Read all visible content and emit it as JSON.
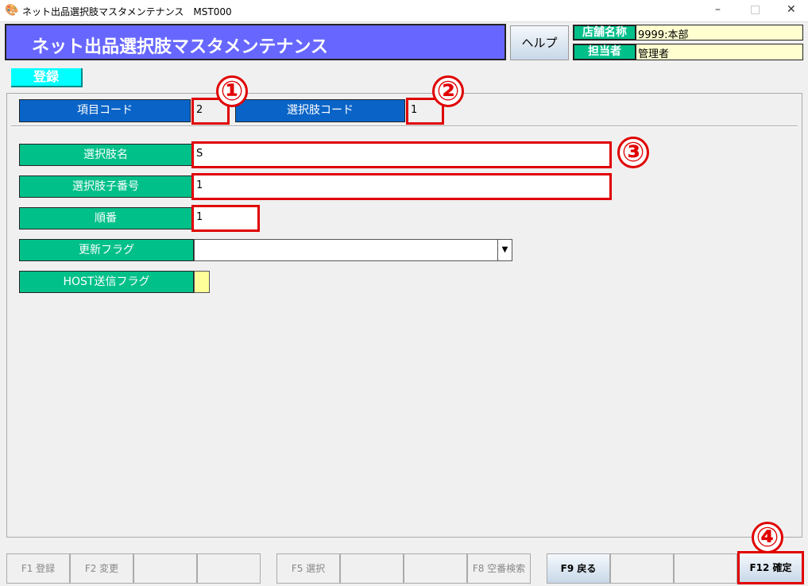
{
  "window": {
    "title": "ネット出品選択肢マスタメンテナンス　MST000",
    "minimize": "–",
    "maximize": "□",
    "close": "✕"
  },
  "header": {
    "title": "ネット出品選択肢マスタメンテナンス",
    "help": "ヘルプ",
    "store_label": "店舗名称",
    "store_value": "9999:本部",
    "staff_label": "担当者",
    "staff_value": "管理者"
  },
  "mode": "登録",
  "keys": {
    "item_code_label": "項目コード",
    "item_code": "2",
    "choice_code_label": "選択肢コード",
    "choice_code": "1"
  },
  "form": {
    "choice_name_label": "選択肢名",
    "choice_name": "S",
    "child_no_label": "選択肢子番号",
    "child_no": "1",
    "order_label": "順番",
    "order": "1",
    "update_flag_label": "更新フラグ",
    "update_flag": "",
    "host_flag_label": "HOST送信フラグ"
  },
  "annotations": [
    "①",
    "②",
    "③",
    "④"
  ],
  "fkeys": [
    "F1 登録",
    "F2 変更",
    "",
    "",
    "F5 選択",
    "",
    "",
    "F8 空番検索",
    "F9 戻る",
    "",
    "",
    "F12 確定"
  ]
}
